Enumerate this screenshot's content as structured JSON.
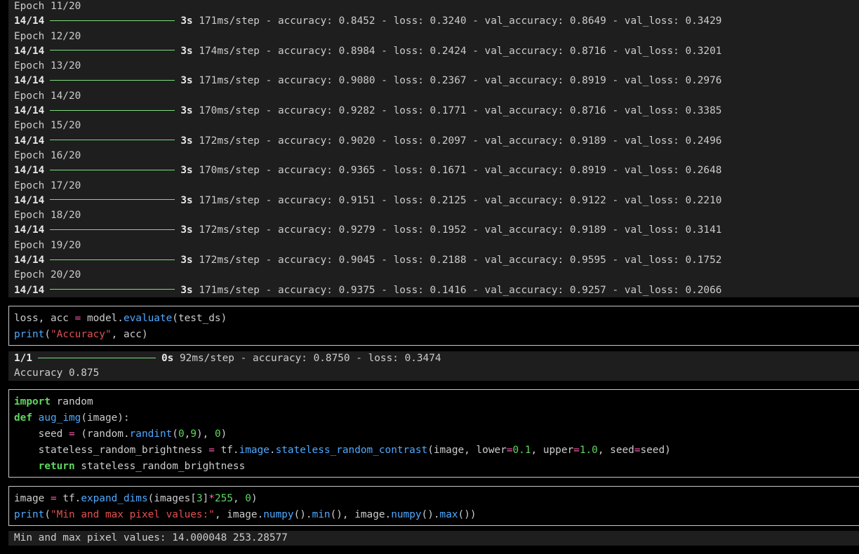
{
  "training_log": [
    {
      "epoch": "Epoch 11/20",
      "step": "14/14",
      "time": "3s",
      "rest": "171ms/step - accuracy: 0.8452 - loss: 0.3240 - val_accuracy: 0.8649 - val_loss: 0.3429"
    },
    {
      "epoch": "Epoch 12/20",
      "step": "14/14",
      "time": "3s",
      "rest": "174ms/step - accuracy: 0.8984 - loss: 0.2424 - val_accuracy: 0.8716 - val_loss: 0.3201"
    },
    {
      "epoch": "Epoch 13/20",
      "step": "14/14",
      "time": "3s",
      "rest": "171ms/step - accuracy: 0.9080 - loss: 0.2367 - val_accuracy: 0.8919 - val_loss: 0.2976"
    },
    {
      "epoch": "Epoch 14/20",
      "step": "14/14",
      "time": "3s",
      "rest": "170ms/step - accuracy: 0.9282 - loss: 0.1771 - val_accuracy: 0.8716 - val_loss: 0.3385"
    },
    {
      "epoch": "Epoch 15/20",
      "step": "14/14",
      "time": "3s",
      "rest": "172ms/step - accuracy: 0.9020 - loss: 0.2097 - val_accuracy: 0.9189 - val_loss: 0.2496"
    },
    {
      "epoch": "Epoch 16/20",
      "step": "14/14",
      "time": "3s",
      "rest": "170ms/step - accuracy: 0.9365 - loss: 0.1671 - val_accuracy: 0.8919 - val_loss: 0.2648"
    },
    {
      "epoch": "Epoch 17/20",
      "step": "14/14",
      "time": "3s",
      "rest": "171ms/step - accuracy: 0.9151 - loss: 0.2125 - val_accuracy: 0.9122 - val_loss: 0.2210"
    },
    {
      "epoch": "Epoch 18/20",
      "step": "14/14",
      "time": "3s",
      "rest": "172ms/step - accuracy: 0.9279 - loss: 0.1952 - val_accuracy: 0.9189 - val_loss: 0.3141"
    },
    {
      "epoch": "Epoch 19/20",
      "step": "14/14",
      "time": "3s",
      "rest": "172ms/step - accuracy: 0.9045 - loss: 0.2188 - val_accuracy: 0.9595 - val_loss: 0.1752"
    },
    {
      "epoch": "Epoch 20/20",
      "step": "14/14",
      "time": "3s",
      "rest": "171ms/step - accuracy: 0.9375 - loss: 0.1416 - val_accuracy: 0.9257 - val_loss: 0.2066"
    }
  ],
  "cell_evaluate": {
    "l1": {
      "a": "loss, acc ",
      "op": "=",
      "b": " model.",
      "fn": "evaluate",
      "c": "(test_ds)"
    },
    "l2": {
      "fn": "print",
      "a": "(",
      "str": "\"Accuracy\"",
      "b": ", acc)"
    }
  },
  "eval_output": {
    "step": "1/1",
    "time": "0s",
    "rest": "92ms/step - accuracy: 0.8750 - loss: 0.3474",
    "result": "Accuracy 0.875"
  },
  "cell_aug": {
    "l1": {
      "kw": "import",
      "a": " random"
    },
    "l2": {
      "kw": "def",
      "a": " ",
      "fn": "aug_img",
      "b": "(image):"
    },
    "l3": {
      "a": "    seed ",
      "op": "=",
      "b": " (random.",
      "fn": "randint",
      "c": "(",
      "n1": "0",
      "d": ",",
      "n2": "9",
      "e": "), ",
      "n3": "0",
      "f": ")"
    },
    "l4": {
      "a": "    stateless_random_brightness ",
      "op1": "=",
      "b": " tf.",
      "fn1": "image",
      "c": ".",
      "fn2": "stateless_random_contrast",
      "d": "(image, lower",
      "op2": "=",
      "n1": "0.1",
      "e": ", upper",
      "op3": "=",
      "n2": "1.0",
      "f": ", seed",
      "op4": "=",
      "g": "seed)"
    },
    "l5": {
      "a": "    ",
      "kw": "return",
      "b": " stateless_random_brightness"
    }
  },
  "cell_expand": {
    "l1": {
      "a": "image ",
      "op1": "=",
      "b": " tf.",
      "fn": "expand_dims",
      "c": "(images[",
      "n1": "3",
      "d": "]",
      "op2": "*",
      "n2": "255",
      "e": ", ",
      "n3": "0",
      "f": ")"
    },
    "l2": {
      "fn1": "print",
      "a": "(",
      "str": "\"Min and max pixel values:\"",
      "b": ", image.",
      "fn2": "numpy",
      "c": "().",
      "fn3": "min",
      "d": "(), image.",
      "fn4": "numpy",
      "e": "().",
      "fn5": "max",
      "f": "())"
    }
  },
  "minmax_output": "Min and max pixel values: 14.000048 253.28577"
}
